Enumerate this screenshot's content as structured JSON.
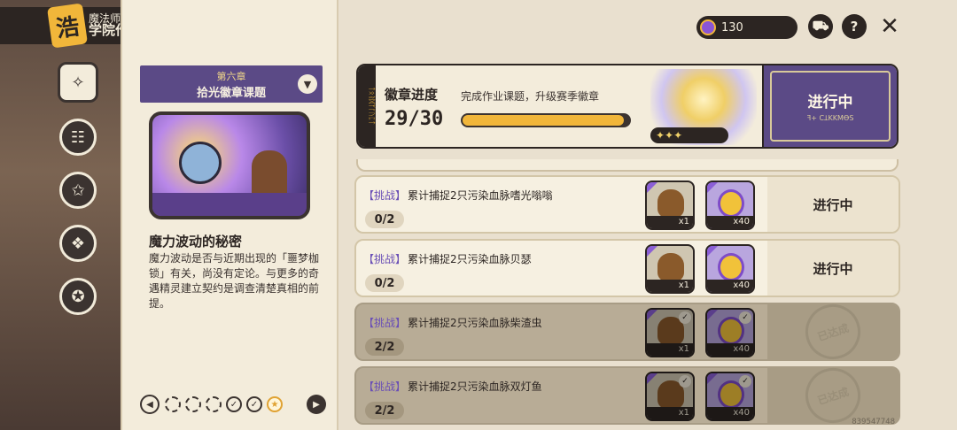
{
  "header": {
    "small_title": "魔法师手册",
    "big_title": "学院作业",
    "logo_char": "浩"
  },
  "nav": {
    "items": [
      {
        "icon": "compass-icon"
      },
      {
        "icon": "book-icon"
      },
      {
        "icon": "stars-icon"
      },
      {
        "icon": "paw-icon"
      },
      {
        "icon": "star-scroll-icon"
      }
    ]
  },
  "chapter": {
    "subtitle": "第六章",
    "title": "拾光徽章课题"
  },
  "story": {
    "title": "魔力波动的秘密",
    "text": "魔力波动是否与近期出现的「噩梦枷锁」有关，尚没有定论。与更多的奇遇精灵建立契约是调查清楚真相的前提。"
  },
  "currency": {
    "amount": "130",
    "icon": "coin-icon",
    "color": "#8a55d6"
  },
  "top_icons": [
    "cart-icon",
    "help-icon",
    "close-icon"
  ],
  "badge": {
    "label": "徽章进度",
    "description": "完成作业课题，升级赛季徽章",
    "count": "29/30",
    "progress": 0.967,
    "stars": "✦✦✦",
    "status": "进行中",
    "status_runes": "ꟻ+ CꞱKKMꝊS",
    "side_runes": "ᛏᛟᚱᛞᛉᚴᚢᛈᛏ"
  },
  "tasks": [
    {
      "tag": "【挑战】",
      "desc": "累计捕捉2只污染血脉嗜光嗡嗡",
      "progress": "0/2",
      "rewards": [
        {
          "type": "acorn",
          "qty": "x1"
        },
        {
          "type": "coin",
          "qty": "x40"
        }
      ],
      "status": "进行中",
      "done": false
    },
    {
      "tag": "【挑战】",
      "desc": "累计捕捉2只污染血脉贝瑟",
      "progress": "0/2",
      "rewards": [
        {
          "type": "acorn",
          "qty": "x1"
        },
        {
          "type": "coin",
          "qty": "x40"
        }
      ],
      "status": "进行中",
      "done": false
    },
    {
      "tag": "【挑战】",
      "desc": "累计捕捉2只污染血脉柴渣虫",
      "progress": "2/2",
      "rewards": [
        {
          "type": "acorn",
          "qty": "x1"
        },
        {
          "type": "coin",
          "qty": "x40"
        }
      ],
      "status": "已达成",
      "done": true
    },
    {
      "tag": "【挑战】",
      "desc": "累计捕捉2只污染血脉双灯鱼",
      "progress": "2/2",
      "rewards": [
        {
          "type": "acorn",
          "qty": "x1"
        },
        {
          "type": "coin",
          "qty": "x40"
        }
      ],
      "status": "已达成",
      "done": true
    }
  ],
  "pager": {
    "dots": [
      "current",
      "normal",
      "normal",
      "check",
      "check",
      "star"
    ]
  },
  "uid": "839547748",
  "colors": {
    "accent_purple": "#5b4a86",
    "gold": "#f1b63a",
    "dark": "#2c2522",
    "paper": "#f3ecdb"
  }
}
